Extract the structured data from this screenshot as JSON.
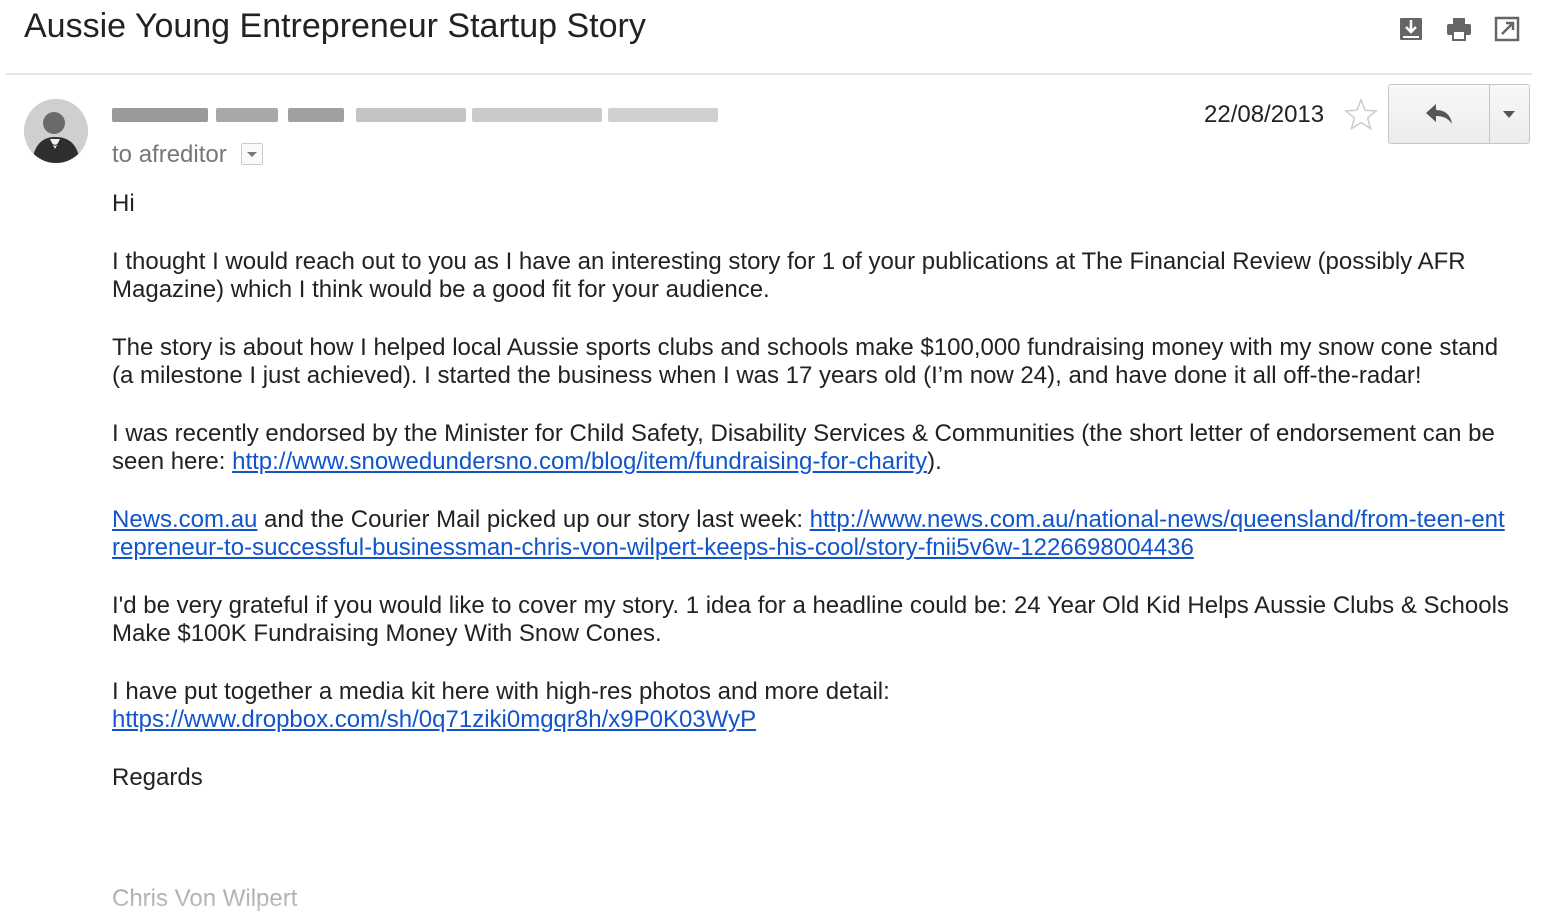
{
  "header": {
    "subject": "Aussie Young Entrepreneur Startup Story",
    "icons": [
      "download-icon",
      "print-icon",
      "open-in-new-window-icon"
    ]
  },
  "message": {
    "sender_avatar_icon": "user-avatar",
    "recipient_prefix": "to",
    "recipient": "afreditor",
    "date": "22/08/2013",
    "star_icon": "star-outline-icon",
    "reply_icon": "reply-arrow-icon",
    "more_icon": "caret-down-icon"
  },
  "body": {
    "greeting": "Hi",
    "p1": "I thought I would reach out to you as I have an interesting story for 1 of your publications at The Financial Review (possibly AFR Magazine) which I think would be a good fit for your audience.",
    "p2": "The story is about how I helped local Aussie sports clubs and schools make $100,000 fundraising money with my snow cone stand (a milestone I just achieved). I started the business when I was 17 years old (I’m now 24), and have done it all off-the-radar!",
    "p3_before": "I was recently endorsed by the Minister for Child Safety, Disability Services & Communities (the short letter of endorsement can be seen here: ",
    "p3_link": "http://www.snowedundersno.com/blog/item/fundraising-for-charity",
    "p3_after": ").",
    "p4_link1": "News.com.au",
    "p4_middle": " and the Courier Mail picked up our story last week: ",
    "p4_link2": "http://www.news.com.au/national-news/queensland/from-teen-entrepreneur-to-successful-businessman-chris-von-wilpert-keeps-his-cool/story-fnii5v6w-1226698004436",
    "p5": "I'd be very grateful if you would like to cover my story. 1 idea for a headline could be: 24 Year Old Kid Helps Aussie Clubs & Schools Make $100K Fundraising Money With Snow Cones.",
    "p6_before": "I have put together a media kit here with high-res photos and more detail: ",
    "p6_link": "https://www.dropbox.com/sh/0q71ziki0mgqr8h/x9P0K03WyP",
    "closing": "Regards",
    "signature": "Chris Von Wilpert"
  },
  "colors": {
    "link": "#1155cc",
    "text": "#222222",
    "muted": "#777777"
  }
}
